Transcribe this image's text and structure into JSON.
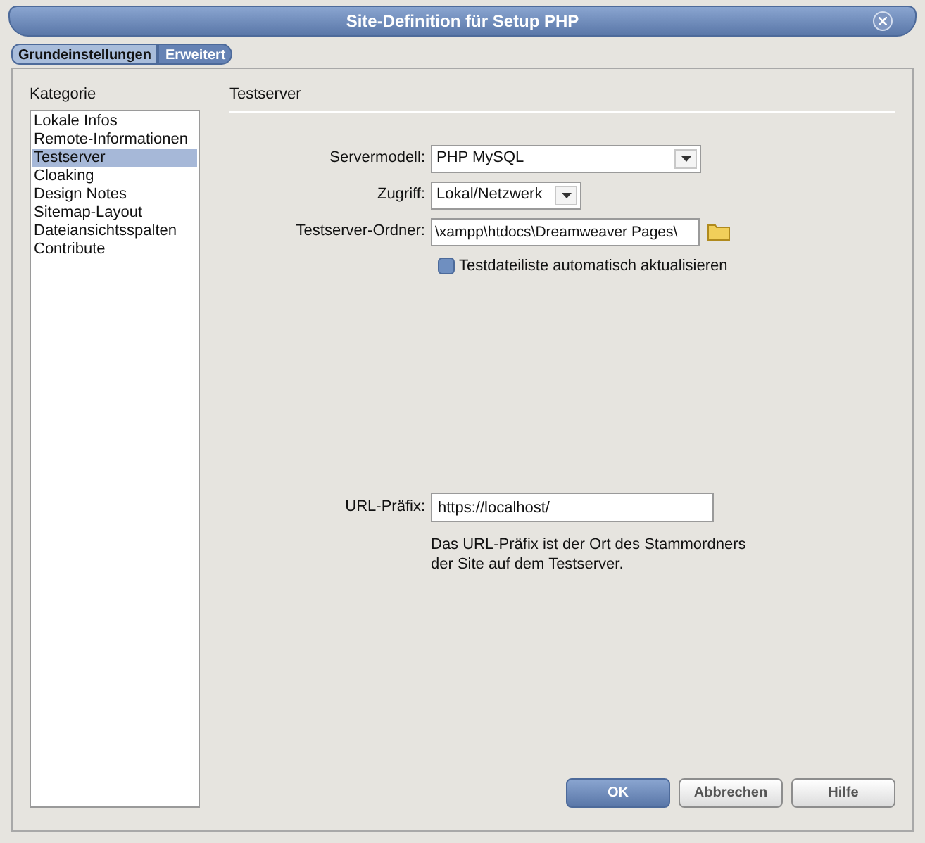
{
  "window": {
    "title": "Site-Definition für Setup PHP"
  },
  "tabs": [
    {
      "label": "Grundeinstellungen",
      "selected": true
    },
    {
      "label": "Erweitert",
      "selected": false
    }
  ],
  "sidebar": {
    "heading": "Kategorie",
    "items": [
      {
        "label": "Lokale Infos",
        "selected": false
      },
      {
        "label": "Remote-Informationen",
        "selected": false
      },
      {
        "label": "Testserver",
        "selected": true
      },
      {
        "label": "Cloaking",
        "selected": false
      },
      {
        "label": "Design Notes",
        "selected": false
      },
      {
        "label": "Sitemap-Layout",
        "selected": false
      },
      {
        "label": "Dateiansichtsspalten",
        "selected": false
      },
      {
        "label": "Contribute",
        "selected": false
      }
    ]
  },
  "section": {
    "title": "Testserver"
  },
  "fields": [
    {
      "kind": "select",
      "label": "Servermodell:",
      "value": "PHP MySQL"
    },
    {
      "kind": "select",
      "label": "Zugriff:",
      "value": "Lokal/Netzwerk"
    },
    {
      "kind": "folder",
      "label": "Testserver-Ordner:",
      "value": "\\xampp\\htdocs\\Dreamweaver Pages\\"
    },
    {
      "kind": "checkbox",
      "label": "Testdateiliste automatisch aktualisieren",
      "checked": false
    }
  ],
  "url": {
    "label": "URL-Präfix:",
    "value": "https://localhost/",
    "hint": "Das URL-Präfix ist der Ort des Stammordners der Site auf dem Testserver."
  },
  "buttons": [
    {
      "label": "OK",
      "kind": "primary"
    },
    {
      "label": "Abbrechen",
      "kind": "normal"
    },
    {
      "label": "Hilfe",
      "kind": "normal"
    }
  ]
}
